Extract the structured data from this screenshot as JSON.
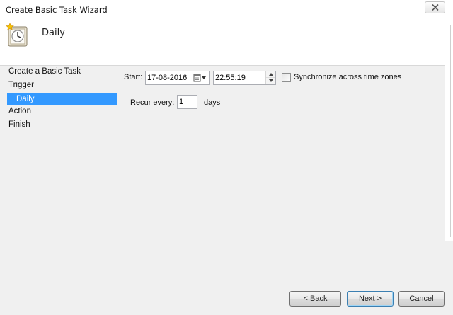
{
  "window": {
    "title": "Create Basic Task Wizard"
  },
  "header": {
    "title": "Daily",
    "icon": "task-clock-icon"
  },
  "nav": {
    "items": [
      {
        "label": "Create a Basic Task",
        "selected": false
      },
      {
        "label": "Trigger",
        "selected": false
      },
      {
        "label": "Daily",
        "selected": true
      },
      {
        "label": "Action",
        "selected": false
      },
      {
        "label": "Finish",
        "selected": false
      }
    ]
  },
  "form": {
    "start_label": "Start:",
    "start_date": "17-08-2016",
    "start_time": "22:55:19",
    "sync_label": "Synchronize across time zones",
    "sync_checked": false,
    "recur_label": "Recur every:",
    "recur_value": "1",
    "recur_unit": "days"
  },
  "buttons": {
    "back": "< Back",
    "next": "Next >",
    "cancel": "Cancel"
  },
  "colors": {
    "selection": "#3399ff",
    "dialog_bg": "#f0f0f0"
  }
}
